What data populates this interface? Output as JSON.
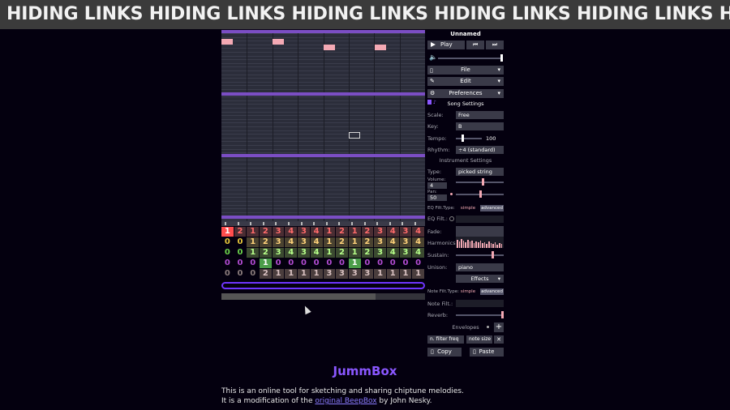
{
  "banner": {
    "text": "HIDING LINKS HIDING LINKS HIDING LINKS HIDING LINKS HIDING LINKS HIDING LINKS"
  },
  "grid": {
    "rows": [
      [
        "1",
        "2",
        "1",
        "2",
        "3",
        "4",
        "3",
        "4",
        "1",
        "2",
        "1",
        "2",
        "3",
        "4",
        "3",
        "4"
      ],
      [
        "0",
        "0",
        "1",
        "2",
        "3",
        "4",
        "3",
        "4",
        "1",
        "2",
        "1",
        "2",
        "3",
        "4",
        "3",
        "4"
      ],
      [
        "0",
        "0",
        "1",
        "2",
        "3",
        "4",
        "3",
        "4",
        "1",
        "2",
        "1",
        "2",
        "3",
        "4",
        "3",
        "4"
      ],
      [
        "0",
        "0",
        "0",
        "1",
        "0",
        "0",
        "0",
        "0",
        "0",
        "0",
        "1",
        "0",
        "0",
        "0",
        "0",
        "0"
      ],
      [
        "0",
        "0",
        "0",
        "2",
        "1",
        "1",
        "1",
        "1",
        "3",
        "3",
        "3",
        "3",
        "1",
        "1",
        "1",
        "1"
      ]
    ]
  },
  "panel": {
    "song_title": "Unnamed",
    "play_label": "Play",
    "file_label": "File",
    "edit_label": "Edit",
    "preferences_label": "Preferences",
    "song_settings_label": "Song Settings",
    "scale_label": "Scale:",
    "scale_value": "Free",
    "key_label": "Key:",
    "key_value": "B",
    "tempo_label": "Tempo:",
    "tempo_value": "100",
    "rhythm_label": "Rhythm:",
    "rhythm_value": "÷4 (standard)",
    "instrument_settings_label": "Instrument Settings",
    "type_label": "Type:",
    "type_value": "picked string",
    "volume_label": "Volume:",
    "volume_value": "4",
    "pan_label": "Pan:",
    "pan_value": "50",
    "eq_filt_type_label": "EQ Filt.Type:",
    "simple_label": "simple",
    "advanced_label": "advanced",
    "eq_filt_label": "EQ Filt.:",
    "fade_label": "Fade:",
    "harmonics_label": "Harmonics:",
    "sustain_label": "Sustain:",
    "unison_label": "Unison:",
    "unison_value": "piano",
    "effects_label": "Effects",
    "note_filt_type_label": "Note Filt.Type:",
    "note_filt_label": "Note Filt.:",
    "reverb_label": "Reverb:",
    "envelopes_label": "Envelopes",
    "env_target_value": "n. filter freq",
    "env_shape_value": "note size",
    "copy_label": "Copy",
    "paste_label": "Paste"
  },
  "footer": {
    "title": "JummBox",
    "line1": "This is an online tool for sketching and sharing chiptune melodies.",
    "line2_prefix": "It is a modification of the ",
    "link_text": "original BeepBox",
    "line2_suffix": " by John Nesky."
  },
  "colors": {
    "accent": "#8a57ff",
    "note": "#f4a9b4",
    "band": "#7b4ec4"
  }
}
